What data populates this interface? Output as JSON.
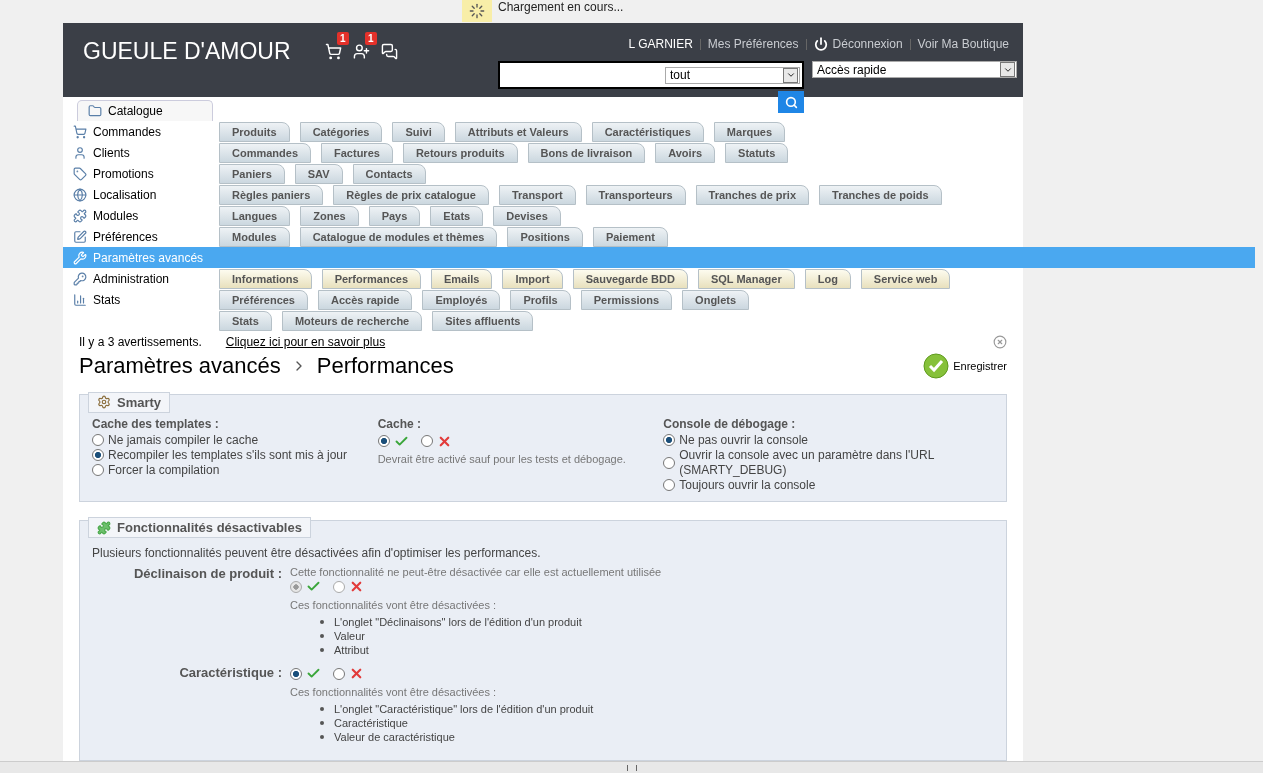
{
  "loading": {
    "text": "Chargement en cours..."
  },
  "header": {
    "shop_name": "GUEULE D'AMOUR",
    "notifications": [
      {
        "kind": "orders",
        "badge": "1"
      },
      {
        "kind": "customers",
        "badge": "1"
      },
      {
        "kind": "messages"
      }
    ],
    "user_links": [
      {
        "kind": "user",
        "label": "L GARNIER"
      },
      {
        "kind": "link",
        "label": "Mes Préférences"
      },
      {
        "kind": "logout",
        "label": "Déconnexion"
      },
      {
        "kind": "link",
        "label": "Voir Ma Boutique"
      }
    ],
    "search": {
      "scope": "tout"
    },
    "quick_access": {
      "value": "Accès rapide"
    }
  },
  "nav": {
    "rows": [
      {
        "main": {
          "label": "Catalogue",
          "selected": false
        },
        "subtabs": []
      },
      {
        "main": {
          "label": "Commandes",
          "selected": false
        },
        "subtabs": [
          "Produits",
          "Catégories",
          "Suivi",
          "Attributs et Valeurs",
          "Caractéristiques",
          "Marques"
        ]
      },
      {
        "main": {
          "label": "Clients",
          "selected": false
        },
        "subtabs": [
          "Commandes",
          "Factures",
          "Retours produits",
          "Bons de livraison",
          "Avoirs",
          "Statuts"
        ]
      },
      {
        "main": {
          "label": "Promotions",
          "selected": false
        },
        "subtabs": [
          "Paniers",
          "SAV",
          "Contacts"
        ]
      },
      {
        "main": {
          "label": "Localisation",
          "selected": false
        },
        "subtabs": [
          "Règles paniers",
          "Règles de prix catalogue",
          "Transport",
          "Transporteurs",
          "Tranches de prix",
          "Tranches de poids"
        ]
      },
      {
        "main": {
          "label": "Modules",
          "selected": false
        },
        "subtabs": [
          "Langues",
          "Zones",
          "Pays",
          "Etats",
          "Devises"
        ]
      },
      {
        "main": {
          "label": "Préférences",
          "selected": false
        },
        "subtabs": [
          "Modules",
          "Catalogue de modules et thèmes",
          "Positions",
          "Paiement"
        ]
      },
      {
        "main": {
          "label": "Paramètres avancés",
          "selected": true
        },
        "subtabs": []
      },
      {
        "main": {
          "label": "Administration",
          "selected": false
        },
        "current": true,
        "subtabs": [
          "Informations",
          "Performances",
          "Emails",
          "Import",
          "Sauvegarde BDD",
          "SQL Manager",
          "Log",
          "Service web"
        ]
      },
      {
        "main": {
          "label": "Stats",
          "selected": false
        },
        "subtabs": [
          "Préférences",
          "Accès rapide",
          "Employés",
          "Profils",
          "Permissions",
          "Onglets"
        ]
      },
      {
        "subtabs": [
          "Stats",
          "Moteurs de recherche",
          "Sites affluents"
        ]
      }
    ]
  },
  "notice": {
    "text": "Il y a 3 avertissements.",
    "link": "Cliquez ici pour en savoir plus"
  },
  "breadcrumb": [
    "Paramètres avancés",
    "Performances"
  ],
  "save": {
    "label": "Enregistrer"
  },
  "smarty": {
    "legend": "Smarty",
    "fields": [
      {
        "kind": "radios",
        "label": "Cache des templates :",
        "options": [
          {
            "label": "Ne jamais compiler le cache",
            "selected": false
          },
          {
            "label": "Recompiler les templates s'ils sont mis à jour",
            "selected": true
          },
          {
            "label": "Forcer la compilation",
            "selected": false
          }
        ]
      },
      {
        "kind": "toggle",
        "label": "Cache :",
        "on": true,
        "hint": "Devrait être activé sauf pour les tests et débogage."
      },
      {
        "kind": "radios",
        "label": "Console de débogage :",
        "options": [
          {
            "label": "Ne pas ouvrir la console",
            "selected": true
          },
          {
            "label": "Ouvrir la console avec un paramètre dans l'URL (SMARTY_DEBUG)",
            "selected": false
          },
          {
            "label": "Toujours ouvrir la console",
            "selected": false
          }
        ]
      }
    ]
  },
  "features": {
    "legend": "Fonctionnalités désactivables",
    "intro": "Plusieurs fonctionnalités peuvent être désactivées afin d'optimiser les performances.",
    "items": [
      {
        "label": "Déclinaison de produit :",
        "note": "Cette fonctionnalité ne peut-être désactivée car elle est actuellement utilisée",
        "on": true,
        "disabled": true,
        "consequence": "Ces fonctionnalités vont être désactivées :",
        "list": [
          "L'onglet \"Déclinaisons\" lors de l'édition d'un produit",
          "Valeur",
          "Attribut"
        ]
      },
      {
        "label": "Caractéristique :",
        "on": true,
        "disabled": false,
        "consequence": "Ces fonctionnalités vont être désactivées :",
        "list": [
          "L'onglet \"Caractéristique\" lors de l'édition d'un produit",
          "Caractéristique",
          "Valeur de caractéristique"
        ]
      }
    ]
  }
}
